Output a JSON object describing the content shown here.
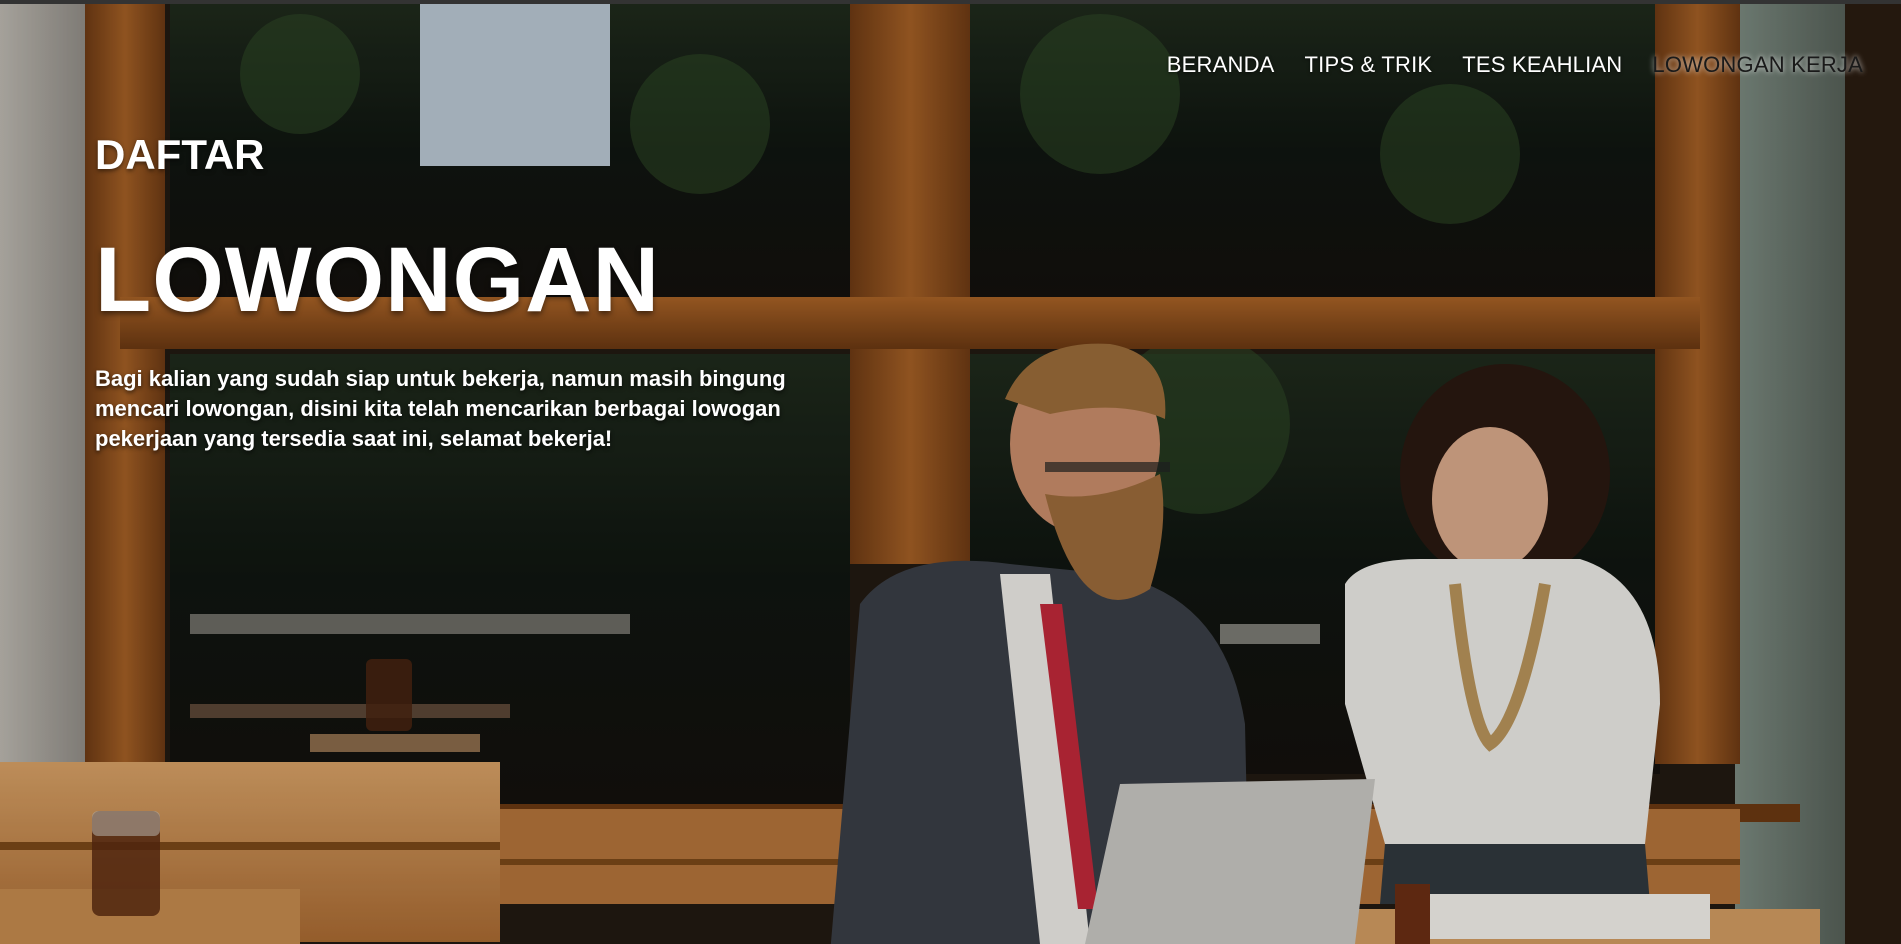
{
  "nav": {
    "items": [
      {
        "label": "BERANDA"
      },
      {
        "label": "TIPS & TRIK"
      },
      {
        "label": "TES KEAHLIAN"
      },
      {
        "label": "LOWONGAN KERJA"
      }
    ]
  },
  "hero": {
    "kicker": "DAFTAR",
    "headline": "LOWONGAN",
    "description": "Bagi kalian yang sudah siap untuk bekerja, namun masih bingung mencari lowongan, disini kita telah mencarikan berbagai lowogan pekerjaan yang tersedia saat ini, selamat bekerja!"
  },
  "colors": {
    "nav_text": "#ffffff",
    "nav_active_text": "#1a1a1a",
    "hero_text": "#ffffff",
    "wood": "#8a4e1e"
  }
}
